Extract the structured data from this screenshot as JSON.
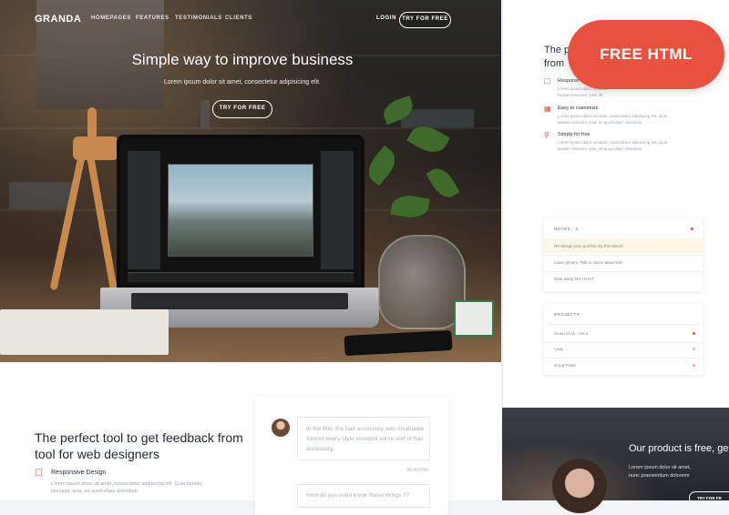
{
  "nav": {
    "logo": "GRANDA",
    "links": [
      "HOMEPAGES",
      "FEATURES",
      "TESTIMONIALS",
      "CLIENTS"
    ],
    "login": "LOGIN",
    "cta": "TRY FOR FREE"
  },
  "hero": {
    "title": "Simple way to improve business",
    "subtitle": "Lorem ipsum dolor sit amet, consectetur adipisicing elit.",
    "cta": "TRY FOR FREE"
  },
  "section": {
    "title": "The perfect tool to get feedback from tool for web designers",
    "feature_title": "Responsive Design",
    "feature_text": "Lorem ipsum dolor sit amet, consectetur adipiscing elit. Quia beatae nesciunt, ipsa, sit quod ullam doloribus."
  },
  "chat": {
    "message": "In the 80s, the hair accessory was invaluable. Almost every style involved some sort of hair accessory.",
    "time": "06:40 PM",
    "message2": "How do you even know these things ??"
  },
  "right_panel": {
    "title": "The p\nfrom",
    "features": [
      {
        "title": "Responsi",
        "text": "Lorem ipsum dolor sit amet,\nbeatae nesciunt, ipsa, sit"
      },
      {
        "title": "Easy to customize",
        "text": "Lorem ipsum dolor sit amet, consectetur adipiscing elit. Quia\nbeatae nesciunt, ipsa, sit quod ullam doloribus."
      },
      {
        "title": "Simply for free",
        "text": "Lorem ipsum dolor sit amet, consectetur adipiscing elit. Quia\nbeatae nesciunt, ipsa, sit quod ullam doloribus."
      }
    ],
    "notes": {
      "header": "NOTES · 3",
      "rows": [
        "Re-design your portfolio by this March",
        "Learn jQuery. Talk to Jason about this",
        "Give away free UI KIT"
      ]
    },
    "projects": {
      "header": "PROJECTS",
      "rows": [
        "Cloud of Ah · Vol 1",
        "Loop",
        "Cut & Paste"
      ]
    }
  },
  "badge": {
    "label": "FREE HTML"
  },
  "dark_panel": {
    "title": "Our product is free, ge",
    "text": "Lorem ipsum dolor sit amet,\nnunc praesentium doloremr",
    "cta": "TRY FOR FR"
  },
  "colors": {
    "accent": "#e8513e",
    "text_dark": "#1f2a36",
    "muted": "#9aa3ad"
  }
}
